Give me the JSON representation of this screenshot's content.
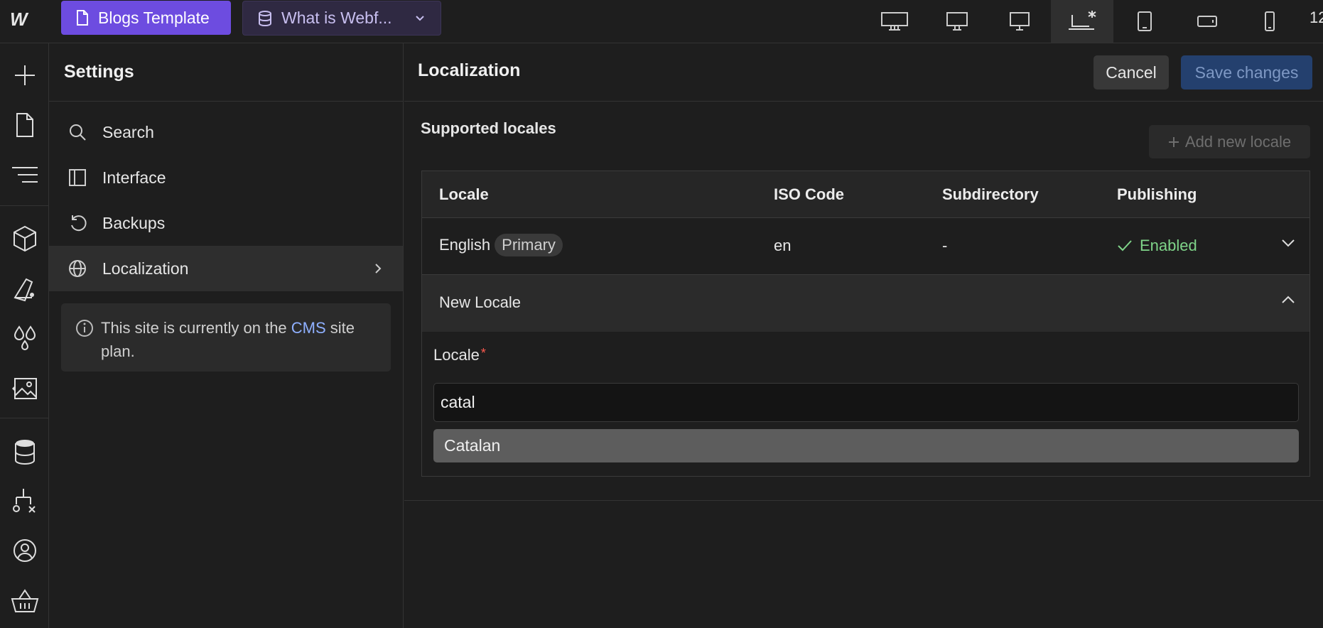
{
  "topbar": {
    "logo": "W",
    "project_label": "Blogs Template",
    "page_label": "What is Webf...",
    "breakpoint_partial": "12"
  },
  "settings": {
    "title": "Settings",
    "menu": [
      {
        "label": "Search",
        "icon": "search-icon"
      },
      {
        "label": "Interface",
        "icon": "sidebar-layout-icon"
      },
      {
        "label": "Backups",
        "icon": "history-icon"
      },
      {
        "label": "Localization",
        "icon": "globe-icon",
        "active": true
      }
    ],
    "info": {
      "prefix": "This site is currently on the ",
      "plan": "CMS",
      "suffix": " site plan."
    }
  },
  "main": {
    "title": "Localization",
    "cancel_label": "Cancel",
    "save_label": "Save changes",
    "section_title": "Supported locales",
    "add_locale_label": "Add new locale",
    "table": {
      "headers": [
        "Locale",
        "ISO Code",
        "Subdirectory",
        "Publishing"
      ],
      "rows": [
        {
          "locale": "English",
          "badge": "Primary",
          "iso": "en",
          "subdirectory": "-",
          "publishing": "Enabled"
        }
      ],
      "new_locale": {
        "title": "New Locale",
        "field_label": "Locale",
        "required_mark": "*",
        "input_value": "catal",
        "suggestion": "Catalan"
      }
    }
  },
  "colors": {
    "accent": "#6d4ce0",
    "save_disabled": "#24406e",
    "enabled_green": "#7fd489",
    "required_red": "#ff5a4f",
    "link": "#8fb0ff"
  }
}
